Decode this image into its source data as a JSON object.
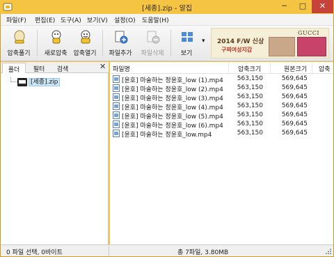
{
  "window": {
    "title": "[세종].zip - 알집",
    "min_label": "─",
    "max_label": "□",
    "close_label": "✕"
  },
  "menu": [
    "파일(F)",
    "편집(E)",
    "도구(A)",
    "보기(V)",
    "설정(O)",
    "도움말(H)"
  ],
  "toolbar": {
    "compress": "압축풀기",
    "new_archive": "새로압축",
    "open_archive": "압축열기",
    "add_file": "파일추가",
    "delete_file": "파일삭제",
    "view": "보기",
    "view_dropdown": "▾"
  },
  "ad": {
    "line1": "2014 F/W 신상",
    "line2": "구찌여성지갑",
    "brand": "GUCCI"
  },
  "left_panel": {
    "tabs": [
      "폴더",
      "필터",
      "검색"
    ],
    "close": "✕",
    "tree_item": "[세종].zip"
  },
  "file_list": {
    "columns": [
      "파일명",
      "압축크기",
      "원본크기",
      "압축"
    ],
    "rows": [
      {
        "name": "[윤호] 마술하는 정윤호_low (1).mp4",
        "compressed": "563,150",
        "original": "569,645"
      },
      {
        "name": "[윤호] 마술하는 정윤호_low (2).mp4",
        "compressed": "563,150",
        "original": "569,645"
      },
      {
        "name": "[윤호] 마술하는 정윤호_low (3).mp4",
        "compressed": "563,150",
        "original": "569,645"
      },
      {
        "name": "[윤호] 마술하는 정윤호_low (4).mp4",
        "compressed": "563,150",
        "original": "569,645"
      },
      {
        "name": "[윤호] 마술하는 정윤호_low (5).mp4",
        "compressed": "563,150",
        "original": "569,645"
      },
      {
        "name": "[윤호] 마술하는 정윤호_low (6).mp4",
        "compressed": "563,150",
        "original": "569,645"
      },
      {
        "name": "[윤호] 마술하는 정윤호_low.mp4",
        "compressed": "563,150",
        "original": "569,645"
      }
    ]
  },
  "status": {
    "left": "0 파일 선택,  0바이트",
    "right": "총 7파일,  3.80MB"
  }
}
